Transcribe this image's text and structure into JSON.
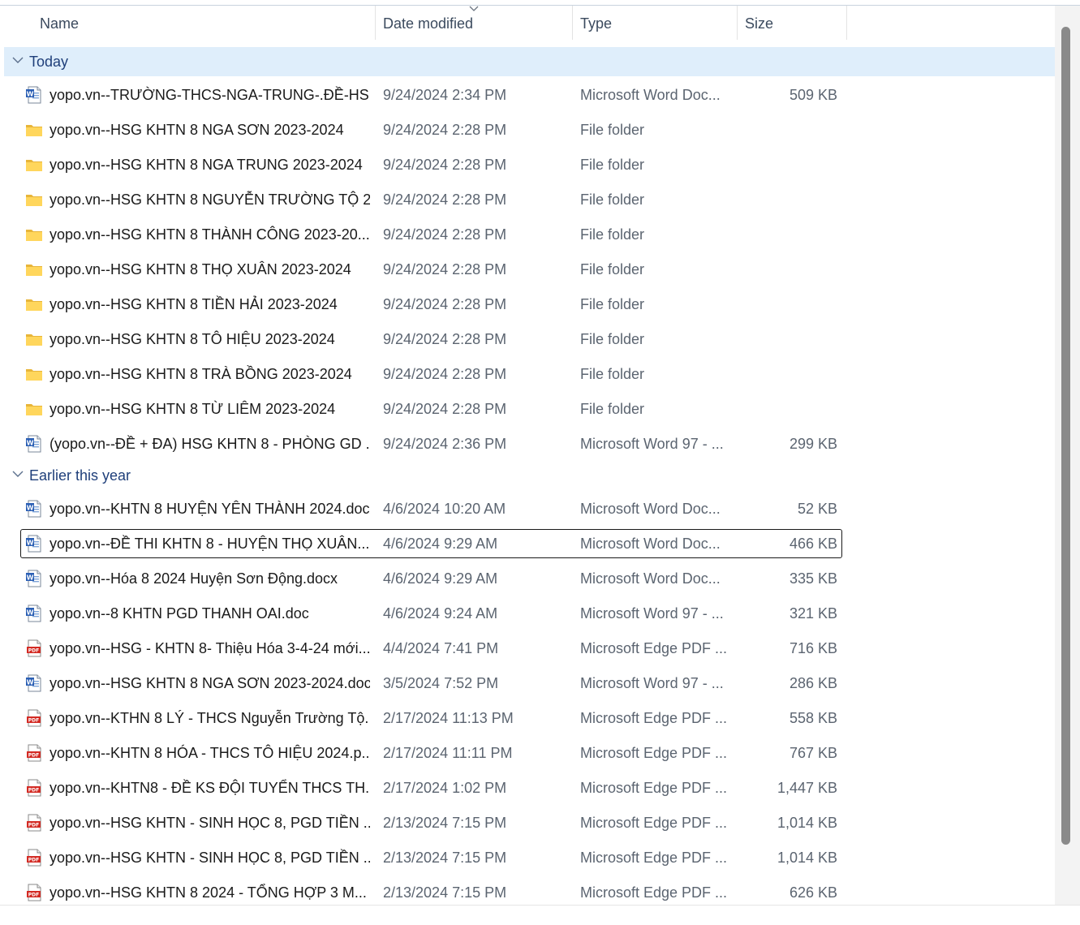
{
  "columns": {
    "name": "Name",
    "date": "Date modified",
    "type": "Type",
    "size": "Size"
  },
  "groups": {
    "today": "Today",
    "earlier": "Earlier this year"
  },
  "rows": [
    {
      "icon": "word-doc-icon",
      "name": "yopo.vn--TRƯỜNG-THCS-NGA-TRUNG-.ĐỀ-HS...",
      "date": "9/24/2024 2:34 PM",
      "type": "Microsoft Word Doc...",
      "size": "509 KB"
    },
    {
      "icon": "folder-icon",
      "name": "yopo.vn--HSG KHTN 8 NGA SƠN 2023-2024",
      "date": "9/24/2024 2:28 PM",
      "type": "File folder",
      "size": ""
    },
    {
      "icon": "folder-icon",
      "name": "yopo.vn--HSG KHTN 8 NGA TRUNG 2023-2024",
      "date": "9/24/2024 2:28 PM",
      "type": "File folder",
      "size": ""
    },
    {
      "icon": "folder-icon",
      "name": "yopo.vn--HSG KHTN 8 NGUYỄN TRƯỜNG TỘ 2...",
      "date": "9/24/2024 2:28 PM",
      "type": "File folder",
      "size": ""
    },
    {
      "icon": "folder-icon",
      "name": "yopo.vn--HSG KHTN 8 THÀNH CÔNG 2023-20...",
      "date": "9/24/2024 2:28 PM",
      "type": "File folder",
      "size": ""
    },
    {
      "icon": "folder-icon",
      "name": "yopo.vn--HSG KHTN 8 THỌ XUÂN 2023-2024",
      "date": "9/24/2024 2:28 PM",
      "type": "File folder",
      "size": ""
    },
    {
      "icon": "folder-icon",
      "name": "yopo.vn--HSG KHTN 8 TIỀN HẢI 2023-2024",
      "date": "9/24/2024 2:28 PM",
      "type": "File folder",
      "size": ""
    },
    {
      "icon": "folder-icon",
      "name": "yopo.vn--HSG KHTN 8 TÔ HIỆU 2023-2024",
      "date": "9/24/2024 2:28 PM",
      "type": "File folder",
      "size": ""
    },
    {
      "icon": "folder-icon",
      "name": "yopo.vn--HSG KHTN 8 TRÀ BỒNG 2023-2024",
      "date": "9/24/2024 2:28 PM",
      "type": "File folder",
      "size": ""
    },
    {
      "icon": "folder-icon",
      "name": "yopo.vn--HSG KHTN 8 TỪ LIÊM 2023-2024",
      "date": "9/24/2024 2:28 PM",
      "type": "File folder",
      "size": ""
    },
    {
      "icon": "word-doc-icon",
      "name": "(yopo.vn--ĐỀ + ĐA) HSG KHTN 8 - PHÒNG GD ...",
      "date": "9/24/2024 2:36 PM",
      "type": "Microsoft Word 97 - ...",
      "size": "299 KB"
    },
    {
      "icon": "word-doc-icon",
      "name": "yopo.vn--KHTN 8 HUYỆN YÊN THÀNH 2024.docx",
      "date": "4/6/2024 10:20 AM",
      "type": "Microsoft Word Doc...",
      "size": "52 KB"
    },
    {
      "icon": "word-doc-icon",
      "name": "yopo.vn--ĐỀ THI KHTN 8 - HUYỆN THỌ XUÂN....",
      "date": "4/6/2024 9:29 AM",
      "type": "Microsoft Word Doc...",
      "size": "466 KB"
    },
    {
      "icon": "word-doc-icon",
      "name": "yopo.vn--Hóa 8  2024 Huyện Sơn Động.docx",
      "date": "4/6/2024 9:29 AM",
      "type": "Microsoft Word Doc...",
      "size": "335 KB"
    },
    {
      "icon": "word-doc-icon",
      "name": "yopo.vn--8 KHTN PGD THANH OAI.doc",
      "date": "4/6/2024 9:24 AM",
      "type": "Microsoft Word 97 - ...",
      "size": "321 KB"
    },
    {
      "icon": "pdf-icon",
      "name": "yopo.vn--HSG - KHTN 8- Thiệu Hóa 3-4-24 mới...",
      "date": "4/4/2024 7:41 PM",
      "type": "Microsoft Edge PDF ...",
      "size": "716 KB"
    },
    {
      "icon": "word-doc-icon",
      "name": "yopo.vn--HSG KHTN 8 NGA SƠN 2023-2024.doc",
      "date": "3/5/2024 7:52 PM",
      "type": "Microsoft Word 97 - ...",
      "size": "286 KB"
    },
    {
      "icon": "pdf-icon",
      "name": "yopo.vn--KTHN 8 LÝ - THCS Nguyễn Trường Tộ....",
      "date": "2/17/2024 11:13 PM",
      "type": "Microsoft Edge PDF ...",
      "size": "558 KB"
    },
    {
      "icon": "pdf-icon",
      "name": "yopo.vn--KHTN 8 HÓA - THCS TÔ HIỆU 2024.p...",
      "date": "2/17/2024 11:11 PM",
      "type": "Microsoft Edge PDF ...",
      "size": "767 KB"
    },
    {
      "icon": "pdf-icon",
      "name": "yopo.vn--KHTN8 - ĐỀ KS ĐỘI TUYỂN THCS TH...",
      "date": "2/17/2024 1:02 PM",
      "type": "Microsoft Edge PDF ...",
      "size": "1,447 KB"
    },
    {
      "icon": "pdf-icon",
      "name": "yopo.vn--HSG KHTN  - SINH HỌC 8, PGD TIỀN ...",
      "date": "2/13/2024 7:15 PM",
      "type": "Microsoft Edge PDF ...",
      "size": "1,014 KB"
    },
    {
      "icon": "pdf-icon",
      "name": "yopo.vn--HSG KHTN  - SINH HỌC 8, PGD TIỀN ...",
      "date": "2/13/2024 7:15 PM",
      "type": "Microsoft Edge PDF ...",
      "size": "1,014 KB"
    },
    {
      "icon": "pdf-icon",
      "name": "yopo.vn--HSG KHTN 8  2024 - TỔNG HỢP 3 M...",
      "date": "2/13/2024 7:15 PM",
      "type": "Microsoft Edge PDF ...",
      "size": "626 KB"
    }
  ]
}
